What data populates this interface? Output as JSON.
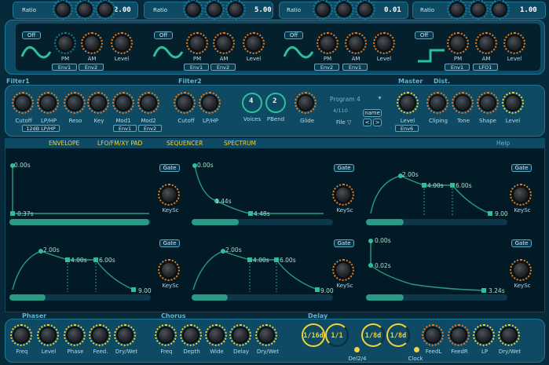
{
  "osc": [
    {
      "ratio_label": "Ratio",
      "ratio_value": "2.00",
      "wave_label": "Off",
      "knobs": [
        "PM",
        "AM",
        "Level"
      ],
      "mods": [
        "Env1",
        "Env2"
      ]
    },
    {
      "ratio_label": "Ratio",
      "ratio_value": "5.00",
      "wave_label": "Off",
      "knobs": [
        "PM",
        "AM",
        "Level"
      ],
      "mods": [
        "Env1",
        "Env2"
      ]
    },
    {
      "ratio_label": "Ratio",
      "ratio_value": "0.01",
      "wave_label": "Off",
      "knobs": [
        "PM",
        "AM",
        "Level"
      ],
      "mods": [
        "Env2",
        "Env1"
      ]
    },
    {
      "ratio_label": "Ratio",
      "ratio_value": "1.00",
      "wave_label": "Off",
      "knobs": [
        "PM",
        "AM",
        "Level"
      ],
      "mods": [
        "Env1",
        "LFO1"
      ]
    }
  ],
  "sections": {
    "filter1": "Filter1",
    "filter2": "Filter2",
    "master": "Master",
    "dist": "Dist."
  },
  "filter": {
    "cutoff": "Cutoff",
    "lphp": "LP/HP",
    "reso": "Reso",
    "key": "Key",
    "mod1": "Mod1",
    "mod2": "Mod2",
    "filter_type": "12dB LP/HP",
    "mod1_src": "Env1",
    "mod2_src": "Env2",
    "cutoff2": "Cutoff",
    "lphp2": "LP/HP"
  },
  "voices": {
    "voices_val": "4",
    "pbend_val": "2",
    "voices_label": "Voices",
    "pbend_label": "PBend",
    "glide_label": "Glide"
  },
  "program": {
    "name": "Program 4",
    "index": "4/110",
    "file_label": "File",
    "name_btn": "name",
    "prev": "<",
    "next": ">",
    "arrow": "▼",
    "file_arrow": "▽"
  },
  "master": {
    "level": "Level",
    "level_src": "Env6",
    "clipping": "Cliping",
    "tone": "Tone",
    "shape": "Shape",
    "level2": "Level"
  },
  "tabs": {
    "envelope": "ENVELOPE",
    "lfo": "LFO/FM/XY PAD",
    "sequencer": "SEQUENCER",
    "spectrum": "SPECTRUM",
    "help": "Help"
  },
  "envelopes": [
    {
      "gate": "Gate",
      "keysc": "KeySc",
      "labels": [
        "0.00s",
        "0.37s"
      ]
    },
    {
      "gate": "Gate",
      "keysc": "KeySc",
      "labels": [
        "0.00s",
        "1.44s",
        "4.48s"
      ]
    },
    {
      "gate": "Gate",
      "keysc": "KeySc",
      "labels": [
        "2.00s",
        "4.00s",
        "6.00s",
        "9.00"
      ]
    },
    {
      "gate": "Gate",
      "keysc": "KeySc",
      "labels": [
        "2.00s",
        "4.00s",
        "6.00s",
        "9.00"
      ]
    },
    {
      "gate": "Gate",
      "keysc": "KeySc",
      "labels": [
        "2.00s",
        "4.00s",
        "6.00s",
        "9.00"
      ]
    },
    {
      "gate": "Gate",
      "keysc": "KeySc",
      "labels": [
        "0.00s",
        "0.02s",
        "3.24s"
      ]
    }
  ],
  "fx": {
    "phaser": "Phaser",
    "chorus": "Chorus",
    "delay": "Delay",
    "phaser_knobs": [
      "Freq",
      "Level",
      "Phase",
      "Feed.",
      "Dry/Wet"
    ],
    "chorus_knobs": [
      "Freq",
      "Depth",
      "Wide",
      "Delay",
      "Dry/Wet"
    ],
    "delay_times": [
      "1/16d",
      "1/1",
      "1/8d",
      "1/8d"
    ],
    "delay_knobs": [
      "FeedL",
      "FeedR",
      "LP",
      "Dry/Wet"
    ],
    "del24": "Del2/4",
    "clock": "Clock"
  },
  "colors": {
    "accent": "#f0d23a",
    "orange": "#f07a1a",
    "teal": "#2a9a86",
    "panel": "#0e4a63"
  }
}
